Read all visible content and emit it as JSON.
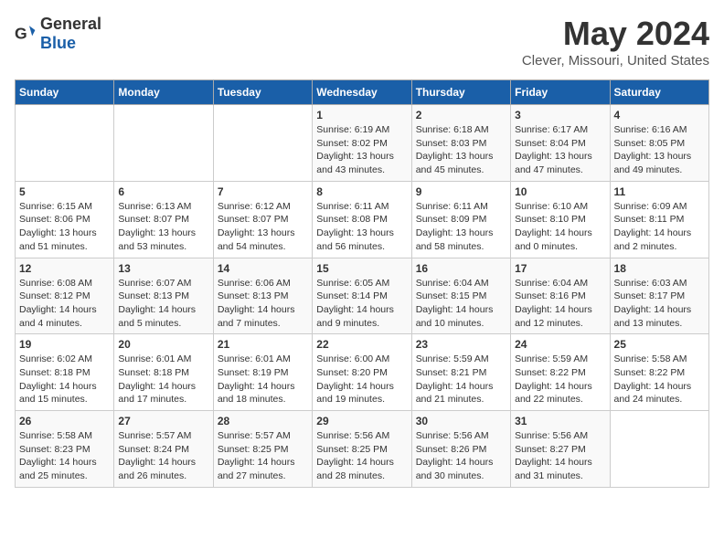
{
  "header": {
    "logo_general": "General",
    "logo_blue": "Blue",
    "title": "May 2024",
    "subtitle": "Clever, Missouri, United States"
  },
  "weekdays": [
    "Sunday",
    "Monday",
    "Tuesday",
    "Wednesday",
    "Thursday",
    "Friday",
    "Saturday"
  ],
  "weeks": [
    [
      {
        "day": "",
        "info": ""
      },
      {
        "day": "",
        "info": ""
      },
      {
        "day": "",
        "info": ""
      },
      {
        "day": "1",
        "info": "Sunrise: 6:19 AM\nSunset: 8:02 PM\nDaylight: 13 hours\nand 43 minutes."
      },
      {
        "day": "2",
        "info": "Sunrise: 6:18 AM\nSunset: 8:03 PM\nDaylight: 13 hours\nand 45 minutes."
      },
      {
        "day": "3",
        "info": "Sunrise: 6:17 AM\nSunset: 8:04 PM\nDaylight: 13 hours\nand 47 minutes."
      },
      {
        "day": "4",
        "info": "Sunrise: 6:16 AM\nSunset: 8:05 PM\nDaylight: 13 hours\nand 49 minutes."
      }
    ],
    [
      {
        "day": "5",
        "info": "Sunrise: 6:15 AM\nSunset: 8:06 PM\nDaylight: 13 hours\nand 51 minutes."
      },
      {
        "day": "6",
        "info": "Sunrise: 6:13 AM\nSunset: 8:07 PM\nDaylight: 13 hours\nand 53 minutes."
      },
      {
        "day": "7",
        "info": "Sunrise: 6:12 AM\nSunset: 8:07 PM\nDaylight: 13 hours\nand 54 minutes."
      },
      {
        "day": "8",
        "info": "Sunrise: 6:11 AM\nSunset: 8:08 PM\nDaylight: 13 hours\nand 56 minutes."
      },
      {
        "day": "9",
        "info": "Sunrise: 6:11 AM\nSunset: 8:09 PM\nDaylight: 13 hours\nand 58 minutes."
      },
      {
        "day": "10",
        "info": "Sunrise: 6:10 AM\nSunset: 8:10 PM\nDaylight: 14 hours\nand 0 minutes."
      },
      {
        "day": "11",
        "info": "Sunrise: 6:09 AM\nSunset: 8:11 PM\nDaylight: 14 hours\nand 2 minutes."
      }
    ],
    [
      {
        "day": "12",
        "info": "Sunrise: 6:08 AM\nSunset: 8:12 PM\nDaylight: 14 hours\nand 4 minutes."
      },
      {
        "day": "13",
        "info": "Sunrise: 6:07 AM\nSunset: 8:13 PM\nDaylight: 14 hours\nand 5 minutes."
      },
      {
        "day": "14",
        "info": "Sunrise: 6:06 AM\nSunset: 8:13 PM\nDaylight: 14 hours\nand 7 minutes."
      },
      {
        "day": "15",
        "info": "Sunrise: 6:05 AM\nSunset: 8:14 PM\nDaylight: 14 hours\nand 9 minutes."
      },
      {
        "day": "16",
        "info": "Sunrise: 6:04 AM\nSunset: 8:15 PM\nDaylight: 14 hours\nand 10 minutes."
      },
      {
        "day": "17",
        "info": "Sunrise: 6:04 AM\nSunset: 8:16 PM\nDaylight: 14 hours\nand 12 minutes."
      },
      {
        "day": "18",
        "info": "Sunrise: 6:03 AM\nSunset: 8:17 PM\nDaylight: 14 hours\nand 13 minutes."
      }
    ],
    [
      {
        "day": "19",
        "info": "Sunrise: 6:02 AM\nSunset: 8:18 PM\nDaylight: 14 hours\nand 15 minutes."
      },
      {
        "day": "20",
        "info": "Sunrise: 6:01 AM\nSunset: 8:18 PM\nDaylight: 14 hours\nand 17 minutes."
      },
      {
        "day": "21",
        "info": "Sunrise: 6:01 AM\nSunset: 8:19 PM\nDaylight: 14 hours\nand 18 minutes."
      },
      {
        "day": "22",
        "info": "Sunrise: 6:00 AM\nSunset: 8:20 PM\nDaylight: 14 hours\nand 19 minutes."
      },
      {
        "day": "23",
        "info": "Sunrise: 5:59 AM\nSunset: 8:21 PM\nDaylight: 14 hours\nand 21 minutes."
      },
      {
        "day": "24",
        "info": "Sunrise: 5:59 AM\nSunset: 8:22 PM\nDaylight: 14 hours\nand 22 minutes."
      },
      {
        "day": "25",
        "info": "Sunrise: 5:58 AM\nSunset: 8:22 PM\nDaylight: 14 hours\nand 24 minutes."
      }
    ],
    [
      {
        "day": "26",
        "info": "Sunrise: 5:58 AM\nSunset: 8:23 PM\nDaylight: 14 hours\nand 25 minutes."
      },
      {
        "day": "27",
        "info": "Sunrise: 5:57 AM\nSunset: 8:24 PM\nDaylight: 14 hours\nand 26 minutes."
      },
      {
        "day": "28",
        "info": "Sunrise: 5:57 AM\nSunset: 8:25 PM\nDaylight: 14 hours\nand 27 minutes."
      },
      {
        "day": "29",
        "info": "Sunrise: 5:56 AM\nSunset: 8:25 PM\nDaylight: 14 hours\nand 28 minutes."
      },
      {
        "day": "30",
        "info": "Sunrise: 5:56 AM\nSunset: 8:26 PM\nDaylight: 14 hours\nand 30 minutes."
      },
      {
        "day": "31",
        "info": "Sunrise: 5:56 AM\nSunset: 8:27 PM\nDaylight: 14 hours\nand 31 minutes."
      },
      {
        "day": "",
        "info": ""
      }
    ]
  ]
}
